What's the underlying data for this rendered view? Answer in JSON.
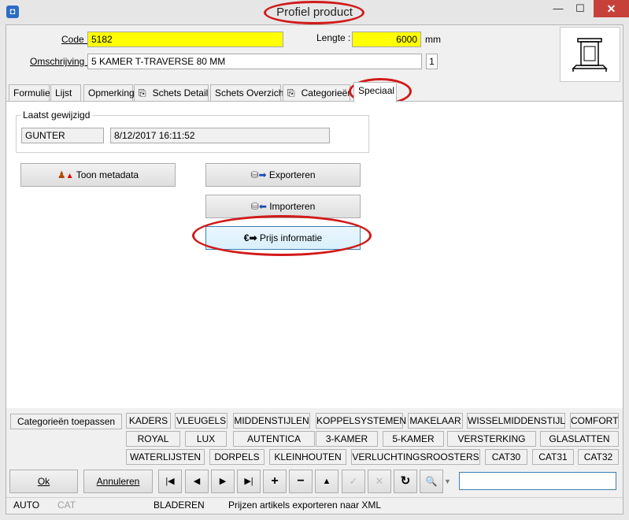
{
  "window": {
    "title": "Profiel product",
    "minimize_glyph": "—",
    "maximize_glyph": "☐",
    "close_glyph": "✕",
    "app_icon": "app-icon"
  },
  "header": {
    "code_label": "Code :",
    "code_value": "5182",
    "lengte_label": "Lengte :",
    "lengte_value": "6000",
    "lengte_unit": "mm",
    "omschrijving_label": "Omschrijving :",
    "omschrijving_value": "5 KAMER T-TRAVERSE 80 MM",
    "omschrijving_count": "1"
  },
  "tabs": [
    {
      "label": "Formulier"
    },
    {
      "label": "Lijst"
    },
    {
      "label": "Opmerking"
    },
    {
      "label": "Schets Detail",
      "icon": "paperclip-icon"
    },
    {
      "label": "Schets Overzicht"
    },
    {
      "label": "Categorieën",
      "icon": "paperclip-icon"
    },
    {
      "label": "Speciaal",
      "active": true
    }
  ],
  "laatst": {
    "legend": "Laatst gewijzigd",
    "user": "GUNTER",
    "datetime": "8/12/2017 16:11:52"
  },
  "buttons": {
    "metadata": "Toon metadata",
    "export": "Exporteren",
    "import": "Importeren",
    "prijs": "Prijs informatie"
  },
  "categories": {
    "apply_label": "Categorieën toepassen",
    "row1": [
      "KADERS",
      "VLEUGELS",
      "MIDDENSTIJLEN",
      "KOPPELSYSTEMEN",
      "MAKELAAR",
      "WISSELMIDDENSTIJL",
      "COMFORT"
    ],
    "row2": [
      "ROYAL",
      "LUX",
      "AUTENTICA",
      "3-KAMER",
      "5-KAMER",
      "VERSTERKING",
      "GLASLATTEN"
    ],
    "row3": [
      "WATERLIJSTEN",
      "DORPELS",
      "KLEINHOUTEN",
      "VERLUCHTINGSROOSTERS",
      "CAT30",
      "CAT31",
      "CAT32"
    ]
  },
  "footer": {
    "ok": "Ok",
    "annuleren": "Annuleren",
    "nav_first": "|◀",
    "nav_prev": "◀",
    "nav_next": "▶",
    "nav_last": "▶|",
    "nav_add": "+",
    "nav_delete": "−",
    "nav_up": "▲",
    "nav_post": "✓",
    "nav_cancel": "✕",
    "nav_refresh": "↻",
    "nav_find": "🔍",
    "search_value": ""
  },
  "status": {
    "mode1": "AUTO",
    "mode2": "CAT",
    "state": "BLADEREN",
    "message": "Prijzen artikels exporteren naar XML"
  },
  "colors": {
    "highlight_yellow": "#ffff00",
    "annotation_red": "#d11a1a",
    "close_red": "#c7413b"
  }
}
